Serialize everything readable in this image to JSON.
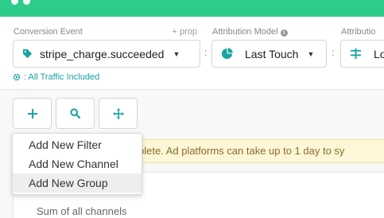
{
  "colors": {
    "brand": "#2ecc8b",
    "accent": "#1aa3a3",
    "warning_bg": "#fdf6d7"
  },
  "filters": {
    "conversion_event": {
      "label": "Conversion Event",
      "prop_label": "+ prop",
      "value": "stripe_charge.succeeded",
      "icon": "tag-icon"
    },
    "attribution_model": {
      "label": "Attribution Model",
      "value": "Last Touch",
      "icon": "pie-chart-icon"
    },
    "attribution_window": {
      "label": "Attributio",
      "value": "Lo",
      "icon": "sliders-icon"
    }
  },
  "traffic_label": ": All Traffic Included",
  "toolbar": {
    "add_icon": "plus-icon",
    "search_icon": "search-icon",
    "move_icon": "move-icon"
  },
  "add_menu": {
    "items": [
      {
        "label": "Add New Filter"
      },
      {
        "label": "Add New Channel"
      },
      {
        "label": "Add New Group"
      }
    ]
  },
  "banner": {
    "text": "plete. Ad platforms can take up to 1 day to sy"
  },
  "table": {
    "row_label": "Sum of all channels"
  }
}
